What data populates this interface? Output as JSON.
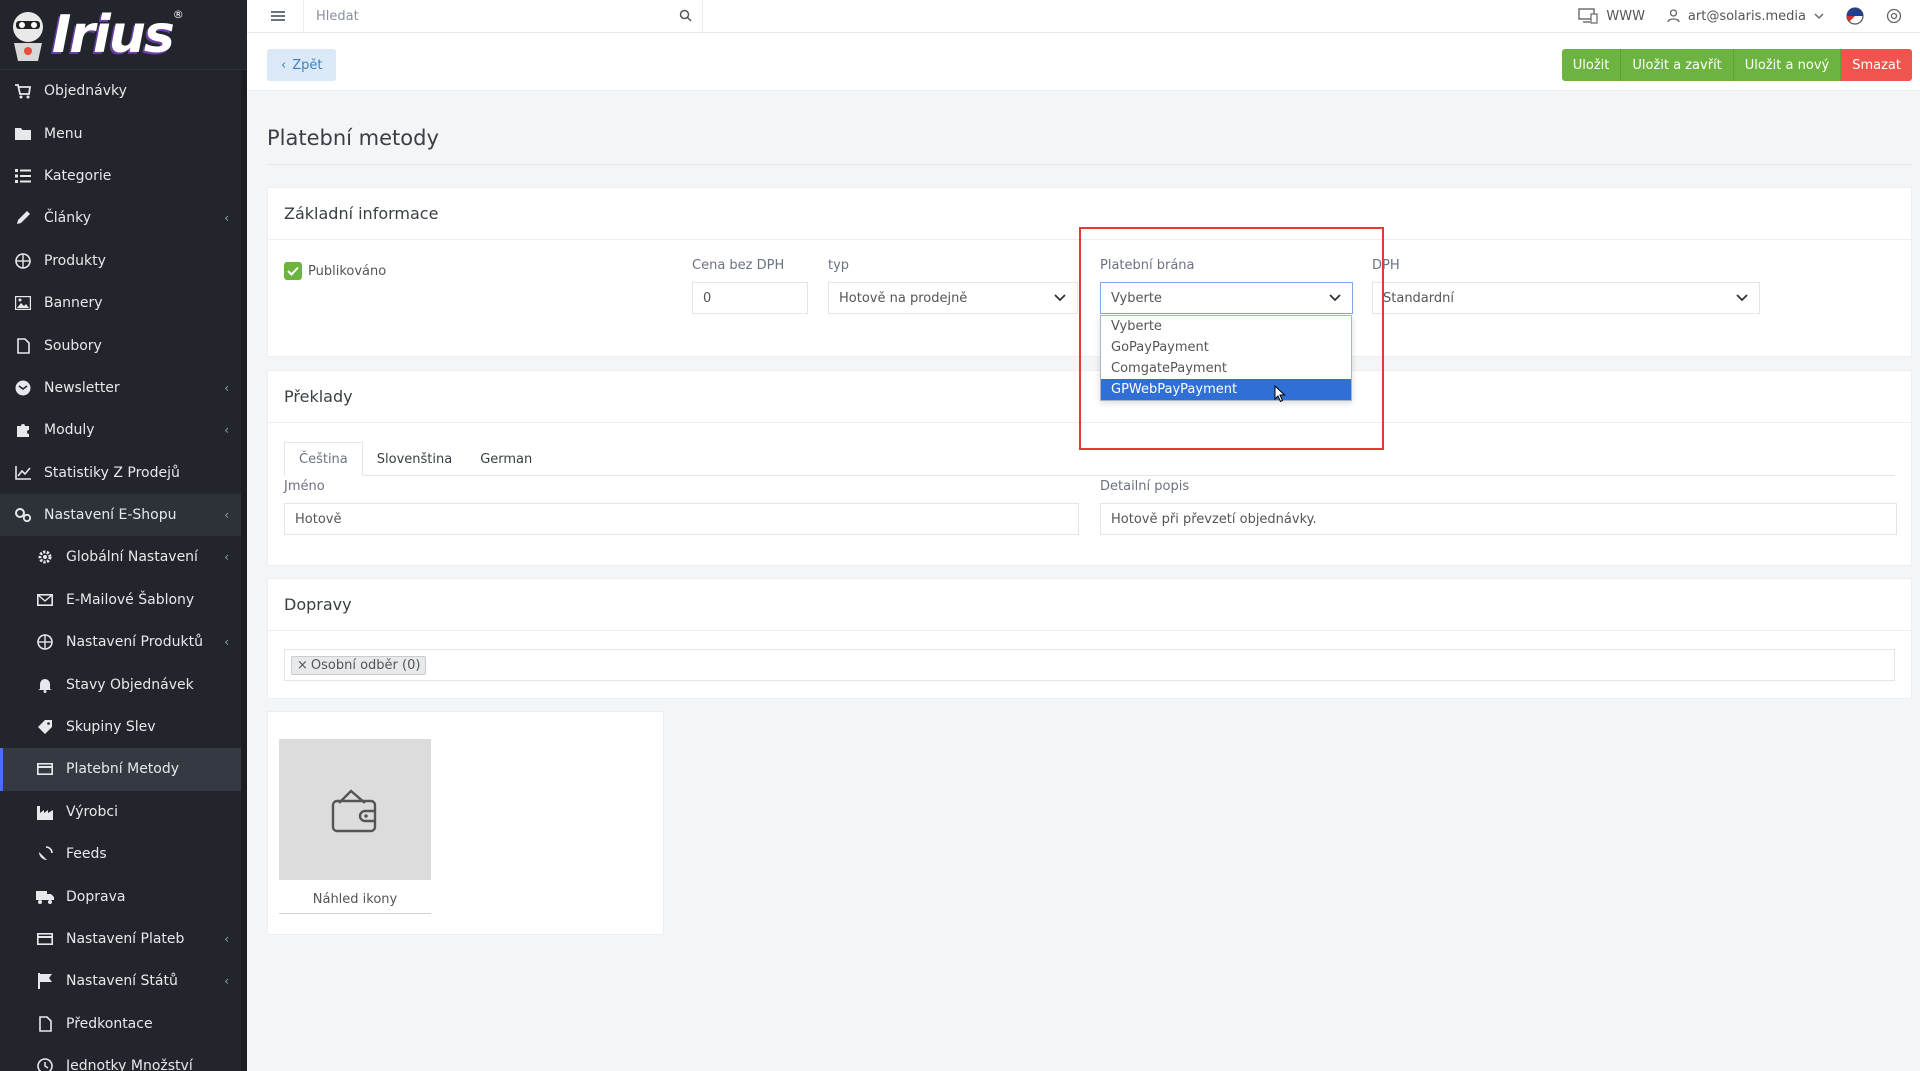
{
  "brand": {
    "logo_text": "Irius"
  },
  "sidebar": {
    "items": [
      {
        "label": "Objednávky",
        "icon": "cart-icon",
        "chevron": false
      },
      {
        "label": "Menu",
        "icon": "folder-icon",
        "chevron": false
      },
      {
        "label": "Kategorie",
        "icon": "list-icon",
        "chevron": false
      },
      {
        "label": "Články",
        "icon": "pencil-icon",
        "chevron": true
      },
      {
        "label": "Produkty",
        "icon": "basketball-icon",
        "chevron": false
      },
      {
        "label": "Bannery",
        "icon": "image-icon",
        "chevron": false
      },
      {
        "label": "Soubory",
        "icon": "file-icon",
        "chevron": false
      },
      {
        "label": "Newsletter",
        "icon": "envelope-circle-icon",
        "chevron": true
      },
      {
        "label": "Moduly",
        "icon": "puzzle-icon",
        "chevron": true
      },
      {
        "label": "Statistiky Z Prodejů",
        "icon": "chart-line-icon",
        "chevron": false
      },
      {
        "label": "Nastavení E-Shopu",
        "icon": "cogs-icon",
        "chevron": true
      },
      {
        "label": "Globální Nastavení",
        "icon": "gear-icon",
        "chevron": true
      },
      {
        "label": "E-Mailové Šablony",
        "icon": "mail-icon",
        "chevron": false
      },
      {
        "label": "Nastavení Produktů",
        "icon": "basketball-icon",
        "chevron": true
      },
      {
        "label": "Stavy Objednávek",
        "icon": "bell-icon",
        "chevron": false
      },
      {
        "label": "Skupiny Slev",
        "icon": "tag-icon",
        "chevron": false
      },
      {
        "label": "Platební Metody",
        "icon": "credit-card-icon",
        "chevron": false
      },
      {
        "label": "Výrobci",
        "icon": "industry-icon",
        "chevron": false
      },
      {
        "label": "Feeds",
        "icon": "satellite-dish-icon",
        "chevron": false
      },
      {
        "label": "Doprava",
        "icon": "truck-icon",
        "chevron": false
      },
      {
        "label": "Nastavení Plateb",
        "icon": "credit-card-icon",
        "chevron": true
      },
      {
        "label": "Nastavení Států",
        "icon": "flag-icon",
        "chevron": true
      },
      {
        "label": "Předkontace",
        "icon": "file-icon",
        "chevron": false
      },
      {
        "label": "Jednotky Množství",
        "icon": "clock-icon",
        "chevron": false
      }
    ]
  },
  "topbar": {
    "search_placeholder": "Hledat",
    "www_label": "WWW",
    "user_email": "art@solaris.media"
  },
  "actionbar": {
    "back_label": "Zpět",
    "save_label": "Uložit",
    "save_close_label": "Uložit a zavřít",
    "save_new_label": "Uložit a nový",
    "delete_label": "Smazat"
  },
  "page_title": "Platební metody",
  "basic_info": {
    "header": "Základní informace",
    "published_label": "Publikováno",
    "price_label": "Cena bez DPH",
    "price_value": "0",
    "type_label": "typ",
    "type_value": "Hotově na prodejně",
    "gateway_label": "Platební brána",
    "gateway_value": "Vyberte",
    "gateway_options": [
      "Vyberte",
      "GoPayPayment",
      "ComgatePayment",
      "GPWebPayPayment"
    ],
    "vat_label": "DPH",
    "vat_value": "Standardní"
  },
  "translations": {
    "header": "Překlady",
    "tabs": [
      "Čeština",
      "Slovenština",
      "German"
    ],
    "name_label": "Jméno",
    "name_value": "Hotově",
    "desc_label": "Detailní popis",
    "desc_value": "Hotově při převzetí objednávky."
  },
  "shipping": {
    "header": "Dopravy",
    "tag_remove": "×",
    "tag_label": "Osobní odběr (0)"
  },
  "icon_preview": {
    "label": "Náhled ikony"
  },
  "colors": {
    "accent_green": "#6db33f",
    "danger_red": "#f0544f",
    "selected_blue": "#2f6fd6",
    "highlight_red": "#e53935",
    "sidebar_bg": "#22262c"
  }
}
